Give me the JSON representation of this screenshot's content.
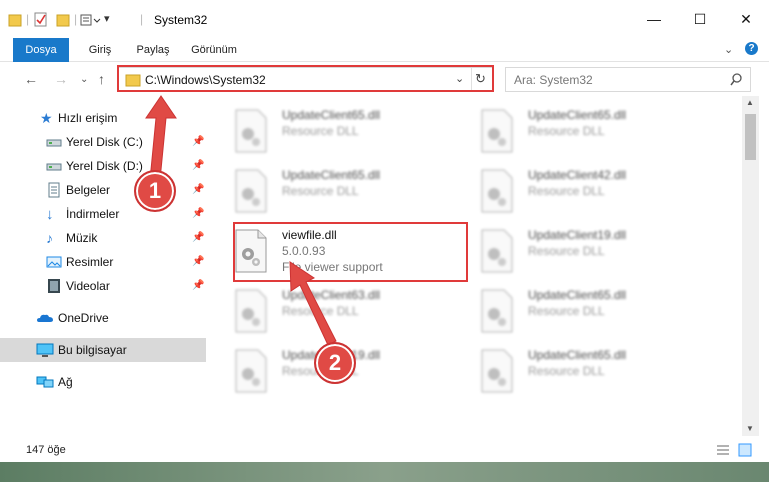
{
  "window": {
    "title": "System32"
  },
  "ribbon": {
    "tabs": [
      "Dosya",
      "Giriş",
      "Paylaş",
      "Görünüm"
    ]
  },
  "address": {
    "path": "C:\\Windows\\System32",
    "search_placeholder": "Ara: System32"
  },
  "sidebar": {
    "items": [
      {
        "label": "Hızlı erişim",
        "icon": "star-icon",
        "pinned": false
      },
      {
        "label": "Yerel Disk (C:)",
        "icon": "drive-icon",
        "pinned": true
      },
      {
        "label": "Yerel Disk (D:)",
        "icon": "drive-icon",
        "pinned": true
      },
      {
        "label": "Belgeler",
        "icon": "documents-icon",
        "pinned": true
      },
      {
        "label": "İndirmeler",
        "icon": "download-icon",
        "pinned": true
      },
      {
        "label": "Müzik",
        "icon": "music-icon",
        "pinned": true
      },
      {
        "label": "Resimler",
        "icon": "pictures-icon",
        "pinned": true
      },
      {
        "label": "Videolar",
        "icon": "video-icon",
        "pinned": true
      },
      {
        "label": "OneDrive",
        "icon": "cloud-icon",
        "pinned": false
      },
      {
        "label": "Bu bilgisayar",
        "icon": "computer-icon",
        "pinned": false,
        "selected": true
      },
      {
        "label": "Ağ",
        "icon": "network-icon",
        "pinned": false
      }
    ]
  },
  "files": {
    "left": [
      {
        "name": "UpdateClient65.dll",
        "type": "Resource DLL"
      },
      {
        "name": "UpdateClient65.dll",
        "type": "Resource DLL"
      },
      {
        "name": "viewfile.dll",
        "version": "5.0.0.93",
        "description": "File viewer support"
      },
      {
        "name": "UpdateClient63.dll",
        "type": "Resource DLL"
      },
      {
        "name": "UpdateClient19.dll",
        "type": "Resource DLL"
      }
    ],
    "right": [
      {
        "name": "UpdateClient65.dll",
        "type": "Resource DLL"
      },
      {
        "name": "UpdateClient42.dll",
        "type": "Resource DLL"
      },
      {
        "name": "UpdateClient19.dll",
        "type": "Resource DLL"
      },
      {
        "name": "UpdateClient65.dll",
        "type": "Resource DLL"
      },
      {
        "name": "UpdateClient65.dll",
        "type": "Resource DLL"
      }
    ]
  },
  "status": {
    "count": "147 öğe"
  },
  "annotations": {
    "badge1": "1",
    "badge2": "2",
    "accent": "#e03a3a"
  }
}
